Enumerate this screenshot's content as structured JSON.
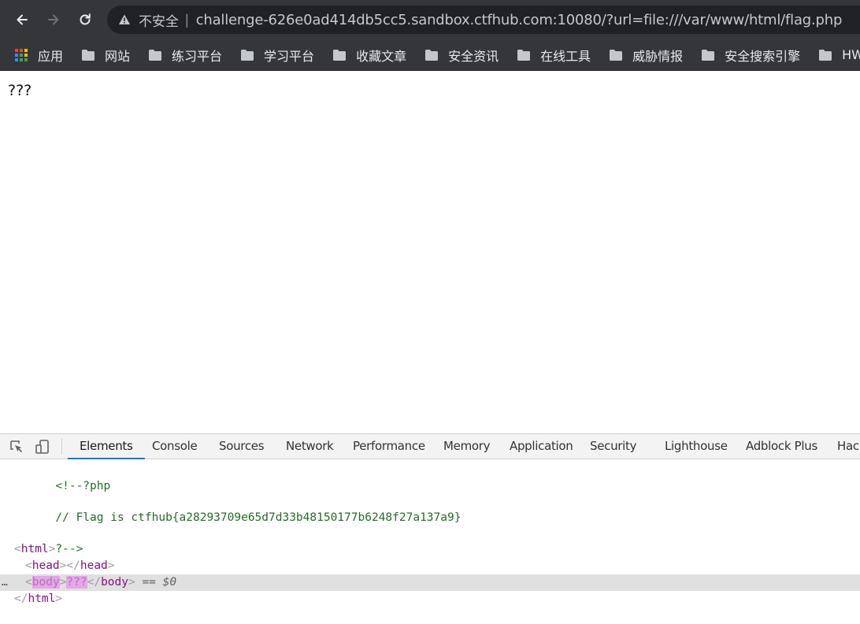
{
  "browser": {
    "insecure_label": "不安全",
    "separator": "|",
    "url": "challenge-626e0ad414db5cc5.sandbox.ctfhub.com:10080/?url=file:///var/www/html/flag.php"
  },
  "bookmarks": [
    {
      "label": "应用",
      "icon": "apps-icon"
    },
    {
      "label": "网站",
      "icon": "folder-icon"
    },
    {
      "label": "练习平台",
      "icon": "folder-icon"
    },
    {
      "label": "学习平台",
      "icon": "folder-icon"
    },
    {
      "label": "收藏文章",
      "icon": "folder-icon"
    },
    {
      "label": "安全资讯",
      "icon": "folder-icon"
    },
    {
      "label": "在线工具",
      "icon": "folder-icon"
    },
    {
      "label": "威胁情报",
      "icon": "folder-icon"
    },
    {
      "label": "安全搜索引擎",
      "icon": "folder-icon"
    },
    {
      "label": "HW",
      "icon": "folder-icon"
    }
  ],
  "page": {
    "body_text": "???"
  },
  "devtools": {
    "tabs": [
      "Elements",
      "Console",
      "Sources",
      "Network",
      "Performance",
      "Memory",
      "Application",
      "Security",
      "Lighthouse",
      "Adblock Plus",
      "Hackbar"
    ],
    "active_tab": "Elements",
    "source": {
      "comment_open": "<!--?php",
      "flag_comment": "// Flag is ctfhub{a28293709e65d7d33b48150177b6248f27a137a9}",
      "comment_close": "?-->",
      "html_tag": "html",
      "head_tag": "head",
      "body_tag": "body",
      "body_content": "???",
      "selected_marker": "== $0",
      "dots": "…"
    }
  },
  "colors": {
    "chrome_toolbar": "#35363a",
    "omnibox": "#202124",
    "active_tab_underline": "#1a73e8",
    "comment": "#236e25",
    "tag": "#881280"
  }
}
